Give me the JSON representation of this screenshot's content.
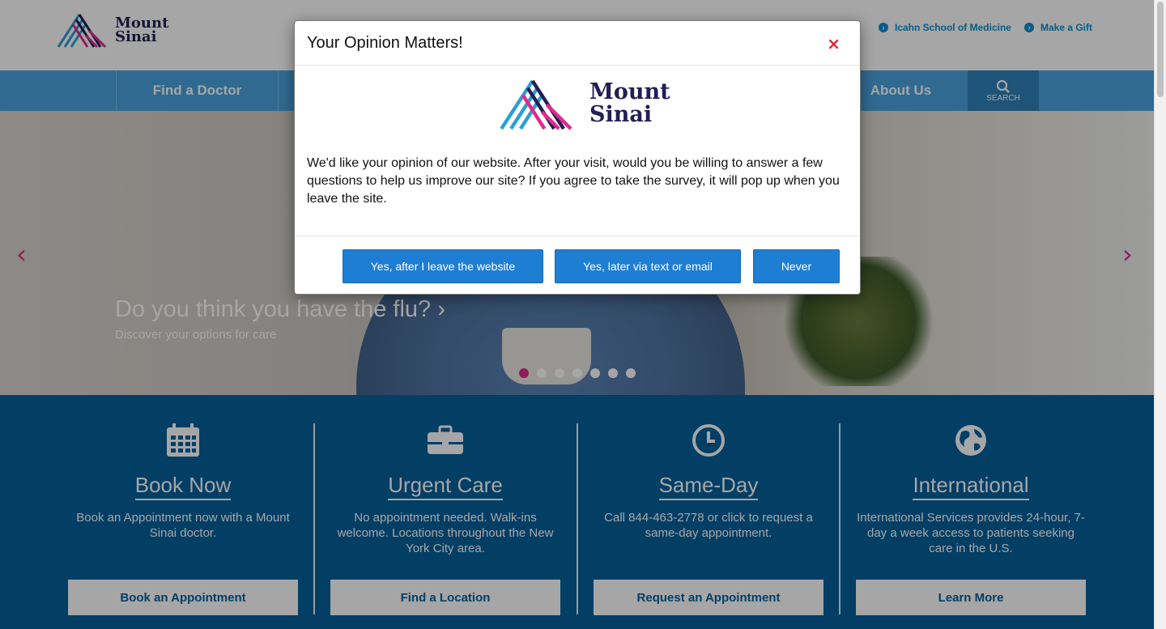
{
  "brand": {
    "logo_line1": "Mount",
    "logo_line2": "Sinai"
  },
  "top_links": [
    {
      "label": "Icahn School of Medicine"
    },
    {
      "label": "Make a Gift"
    }
  ],
  "nav": {
    "items": [
      {
        "label": "Find a Doctor"
      },
      {
        "label": "About Us"
      }
    ],
    "search_label": "SEARCH"
  },
  "hero": {
    "title": "Do you think you have the flu?",
    "subtitle": "Discover your options for care",
    "slide_count": 7,
    "active_slide": 1
  },
  "services": [
    {
      "icon": "calendar-icon",
      "title": "Book Now",
      "description": "Book an Appointment now with a Mount Sinai doctor.",
      "button": "Book an Appointment"
    },
    {
      "icon": "briefcase-icon",
      "title": "Urgent Care",
      "description": "No appointment needed. Walk-ins welcome. Locations throughout the New York City area.",
      "button": "Find a Location"
    },
    {
      "icon": "clock-icon",
      "title": "Same-Day",
      "description": "Call 844-463-2778 or click to request a same-day appointment.",
      "button": "Request an Appointment"
    },
    {
      "icon": "globe-icon",
      "title": "International",
      "description": "International Services provides 24-hour, 7-day a week access to patients seeking care in the U.S.",
      "button": "Learn More"
    }
  ],
  "modal": {
    "title": "Your Opinion Matters!",
    "close": "×",
    "body": "We'd like your opinion of our website. After your visit, would you be willing to answer a few questions to help us improve our site? If you agree to take the survey, it will pop up when you leave the site.",
    "buttons": {
      "yes_after": "Yes, after I leave the website",
      "yes_later": "Yes, later via text or email",
      "never": "Never"
    }
  },
  "colors": {
    "nav_blue": "#4ba4dd",
    "services_blue": "#06609b",
    "accent_pink": "#e02a8d",
    "modal_button": "#1e7ed4",
    "close_red": "#e0222b"
  }
}
